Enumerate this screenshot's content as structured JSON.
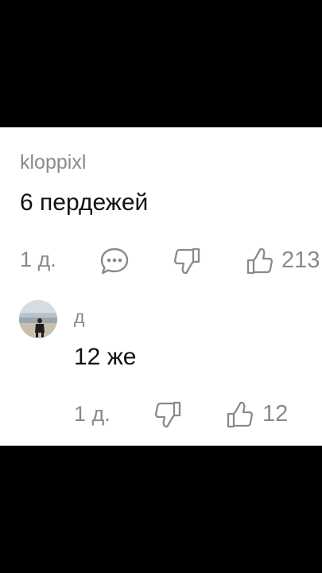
{
  "comment": {
    "username": "kloppixl",
    "text": "6 пердежей",
    "time": "1 д.",
    "like_count": "213"
  },
  "reply": {
    "username": "д",
    "text": "12 же",
    "time": "1 д.",
    "like_count": "12"
  },
  "icons": {
    "reply": "comment-bubble-icon",
    "dislike": "thumbs-down-icon",
    "like": "thumbs-up-icon"
  },
  "colors": {
    "background": "#000000",
    "card": "#ffffff",
    "muted": "#8a8a8a",
    "text": "#111111"
  }
}
